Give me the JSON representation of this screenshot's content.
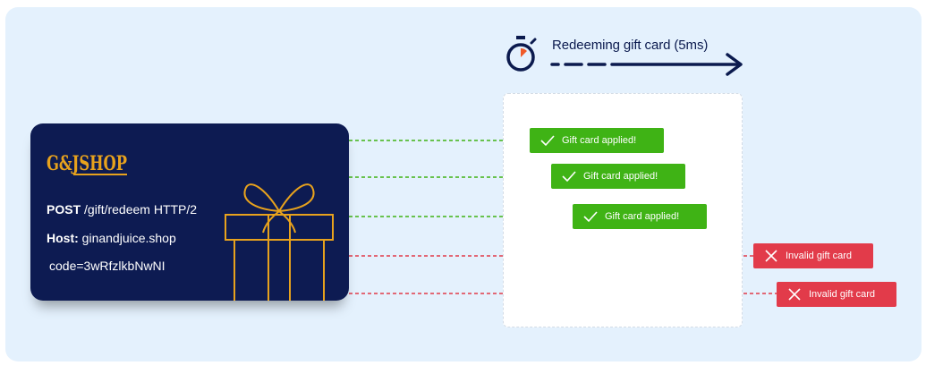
{
  "timer": {
    "label": "Redeeming gift card (5ms)",
    "icon": "stopwatch-icon"
  },
  "card": {
    "logo_text": "G&JSHOP",
    "line1_bold": "POST",
    "line1_rest": " /gift/redeem HTTP/2",
    "line2_bold": "Host:",
    "line2_rest": " ginandjuice.shop",
    "line3": "code=3wRfzlkbNwNI",
    "icon": "gift-box-icon"
  },
  "results": [
    {
      "text": "Gift card applied!",
      "status": "success",
      "icon": "checkmark-icon"
    },
    {
      "text": "Gift card applied!",
      "status": "success",
      "icon": "checkmark-icon"
    },
    {
      "text": "Gift card applied!",
      "status": "success",
      "icon": "checkmark-icon"
    },
    {
      "text": "Invalid gift card",
      "status": "error",
      "icon": "close-icon"
    },
    {
      "text": "Invalid gift card",
      "status": "error",
      "icon": "close-icon"
    }
  ],
  "colors": {
    "success": "#3fb315",
    "error": "#e23b4a",
    "card": "#0d1b52",
    "accent": "#e7a21d"
  }
}
